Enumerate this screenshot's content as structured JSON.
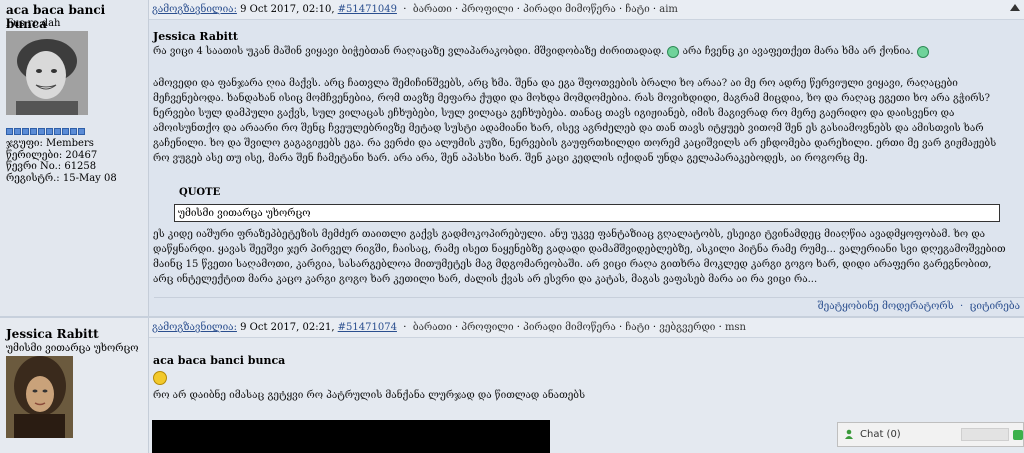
{
  "post1": {
    "user": {
      "name": "aca baca banci bunca",
      "title": "Fus ro dah",
      "info": [
        "ჯგუფი: Members",
        "წერილები: 20467",
        "წევრი No.: 61258",
        "რეგისტრ.: 15-May 08"
      ]
    },
    "header": {
      "link": "გამოგზავნილია:",
      "date": "9 Oct 2017, 02:10",
      "id": "#51471049",
      "actions": [
        "ბარათი",
        "პროფილი",
        "პირადი მიმოწერა",
        "ჩატი",
        "aim"
      ]
    },
    "quoted_author": "Jessica Rabitt",
    "line1": "რა ვიცი 4 საათის უკან მაშინ ვიყავი ბიჭებთან რაღაცაზე ვლაპარაკობდი. მშვიდობაზე ძირითადად.",
    "line1b": "არა ჩვენც კი ავაფეთქეთ მარა ხმა არ ქონია.",
    "para": "ამოვედი და ფანჯარა ღია მაქვს. არც ჩათვლა შემიჩინშვებს, არც ხმა. შენა და ეგა შფოთვების ბრალი ხო არაა? აი მე რო ადრე წერვიული ვიყავი, რაღაცები მეჩვენებოდა. ხანდახან ისიც მომჩვენებია, რომ თავზე მეფარა ქუდი და მოხდა მომდომებია. რას მოვიხდიდი, მაგრამ მიცდია, ხო და რაღაც ეგეთი ხო არა გჭირს? ნერვები სულ დამპული გაქვს, სულ ვილაცას ეჩხუბები, სულ ვილაცა გეჩხუბება. თანაც თავს იგიჟიანებ, იმის მაგივრად რო მერე გაერიდო და დაისვენო და ამოისუნთქო და არაარი რო შენც ჩვეულებრივზე მეტად სუსტი ადამიანი ხარ, ისევ აგრძელებ და თან თავს იტყუებ ვითომ შენ ეს გასიამოვნებს და ამისთვის ხარ გაჩენილი. ხო და შვილო გაგაგიჟებს ეგა. რა ვერძი და ალუმის კუზი, ნერვების გაუფრთხილდი თორემ კაციშვილს არ ეჩდომება დარეხილი. ერთი მე ვარ გიჟმაჟებს რო ვუგებ ასე თუ ისე, მარა შენ ჩამეტანი ხარ. არა არა, შენ აპასხი ხარ. შენ კაცი კედლის იქიდან უნდა გელაპარაკებოდეს, აი როგორც მე.",
    "quote_label": "QUOTE",
    "quote_text": "უმისმი ვითარცა უხორცო",
    "para2": "ეს კიდე იაშური ფრაზეპბეტეზის მემძერ თაითლი გაქვს გადმოკოპირებული. ანუ უკვე ფანტაზიაც გღალატობს, ესეიგი ტვინამდეც მიაღწია ავადმყოფობამ. ხო და დაწყნარდი. ყავას შეეშვი ჯერ პირველ რიგში, ჩაისაც, რამე ისეთ ნაყენებზე გადადი დამამშვიდებლებზე, ასკილი პიტნა რამე რუმე... ვალერიანი სვი დღეგამოშვებით მაინც 15 წვეთი საღამოთი, კარგია, სასარგებლოა მითუმეტეს მაგ მდგომარეობაში. არ ვიცი რაღა გითხრა მოკლედ კარგი გოგო ხარ, დიდი არაფერი გარეგნობით, არც ინტელექტით მარა კაცო კარგი გოგო ხარ კეთილი ხარ, ძალის ქვას არ ესვრი და კატას, მაგას ვაფასებ მარა აი რა ვიცი რა...",
    "footer": [
      "შეატყობინე მოდერატორს",
      "ციტირება"
    ]
  },
  "post2": {
    "user": {
      "name": "Jessica Rabitt",
      "title": "უმისმი ვითარცა უხორცო"
    },
    "header": {
      "link": "გამოგზავნილია:",
      "date": "9 Oct 2017, 02:21",
      "id": "#51471074",
      "actions": [
        "ბარათი",
        "პროფილი",
        "პირადი მიმოწერა",
        "ჩატი",
        "ვებგვერდი",
        "msn"
      ]
    },
    "quoted_author": "aca baca banci bunca",
    "text": "რო არ დაიბნე იმასაც გეტყვი რო პატრულის მანქანა ლურჯად და წითლად ანათებს"
  },
  "chat": {
    "label": "Chat (0)"
  },
  "colors": {
    "link": "#2b4f8f",
    "bg": "#dde4ee",
    "smiley_green": "#6fd39a",
    "smiley_yellow": "#f2c92b"
  }
}
